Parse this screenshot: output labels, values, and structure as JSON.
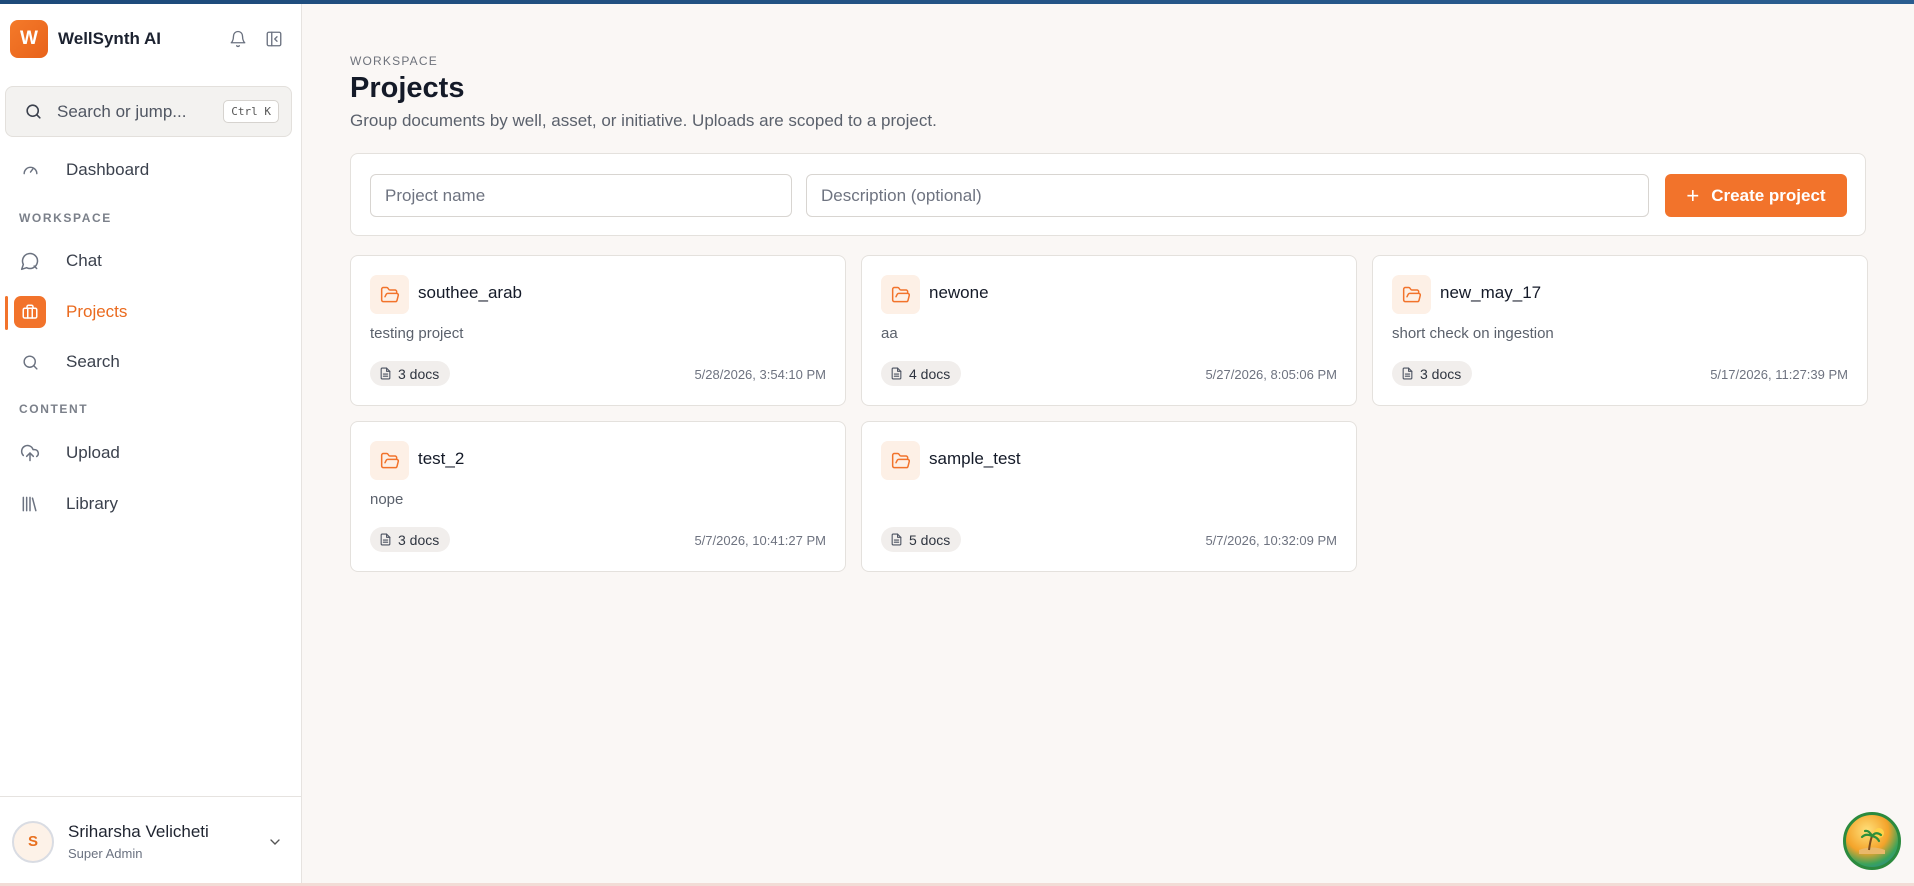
{
  "app": {
    "logo_letter": "W",
    "name": "WellSynth AI"
  },
  "search": {
    "placeholder": "Search or jump...",
    "shortcut": "Ctrl K"
  },
  "nav": {
    "dashboard": "Dashboard",
    "workspace_label": "WORKSPACE",
    "chat": "Chat",
    "projects": "Projects",
    "search": "Search",
    "content_label": "CONTENT",
    "upload": "Upload",
    "library": "Library"
  },
  "user": {
    "initial": "S",
    "name": "Sriharsha Velicheti",
    "role": "Super Admin"
  },
  "page": {
    "eyebrow": "WORKSPACE",
    "title": "Projects",
    "subtitle": "Group documents by well, asset, or initiative. Uploads are scoped to a project."
  },
  "form": {
    "name_placeholder": "Project name",
    "description_placeholder": "Description (optional)",
    "create_label": "Create project"
  },
  "projects": [
    {
      "name": "southee_arab",
      "description": "testing project",
      "docs": "3 docs",
      "date": "5/28/2026, 3:54:10 PM"
    },
    {
      "name": "newone",
      "description": "aa",
      "docs": "4 docs",
      "date": "5/27/2026, 8:05:06 PM"
    },
    {
      "name": "new_may_17",
      "description": "short check on ingestion",
      "docs": "3 docs",
      "date": "5/17/2026, 11:27:39 PM"
    },
    {
      "name": "test_2",
      "description": "nope",
      "docs": "3 docs",
      "date": "5/7/2026, 10:41:27 PM"
    },
    {
      "name": "sample_test",
      "description": "",
      "docs": "5 docs",
      "date": "5/7/2026, 10:32:09 PM"
    }
  ],
  "colors": {
    "accent": "#f2732b",
    "brand_gradient_start": "#f47a2a",
    "topline": "#1d4a7a"
  }
}
